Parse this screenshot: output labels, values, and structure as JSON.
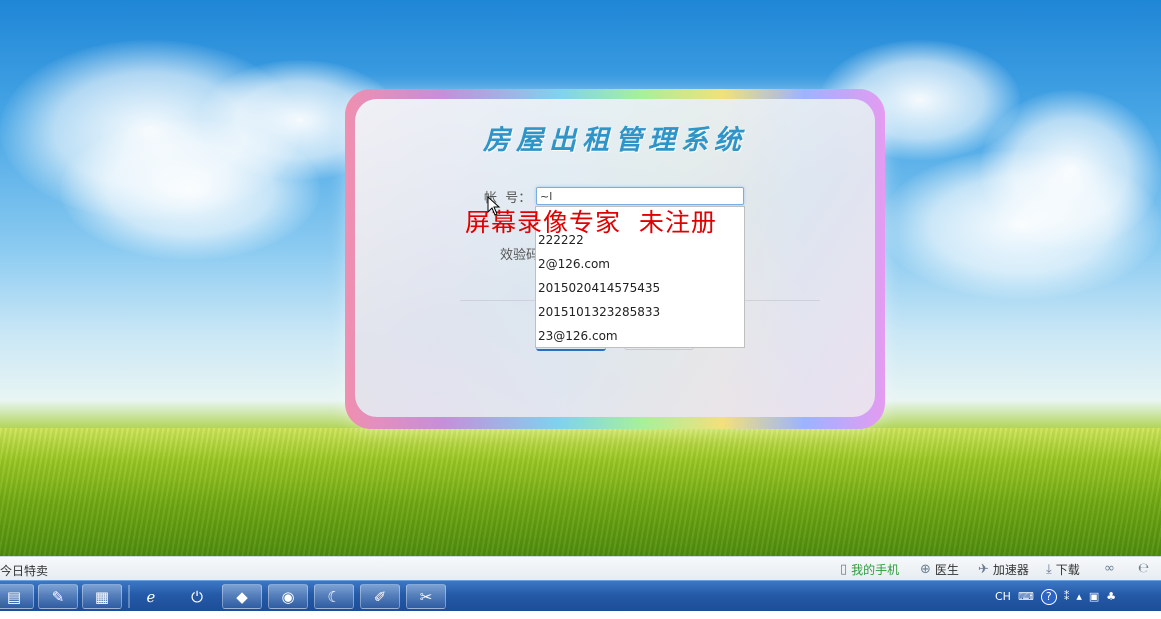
{
  "app": {
    "title": "房屋出租管理系统"
  },
  "login": {
    "account_label": "帐  号：",
    "account_value": "~l",
    "verify_label": "效验码",
    "suggestions": [
      "222222",
      "2@126.com",
      "2015020414575435",
      "2015101323285833",
      "23@126.com"
    ]
  },
  "overlay": {
    "watermark": "屏幕录像专家  未注册"
  },
  "status_bar": {
    "left_text": "今日特卖",
    "items": [
      {
        "icon": "phone-icon",
        "label": "我的手机"
      },
      {
        "icon": "doctor-icon",
        "label": "医生"
      },
      {
        "icon": "rocket-icon",
        "label": "加速器"
      },
      {
        "icon": "download-icon",
        "label": "下载"
      }
    ]
  },
  "taskbar": {
    "tray_lang": "CH"
  },
  "colors": {
    "title": "#2f94c8",
    "watermark": "#e00000",
    "taskbar": "#245aa8"
  }
}
